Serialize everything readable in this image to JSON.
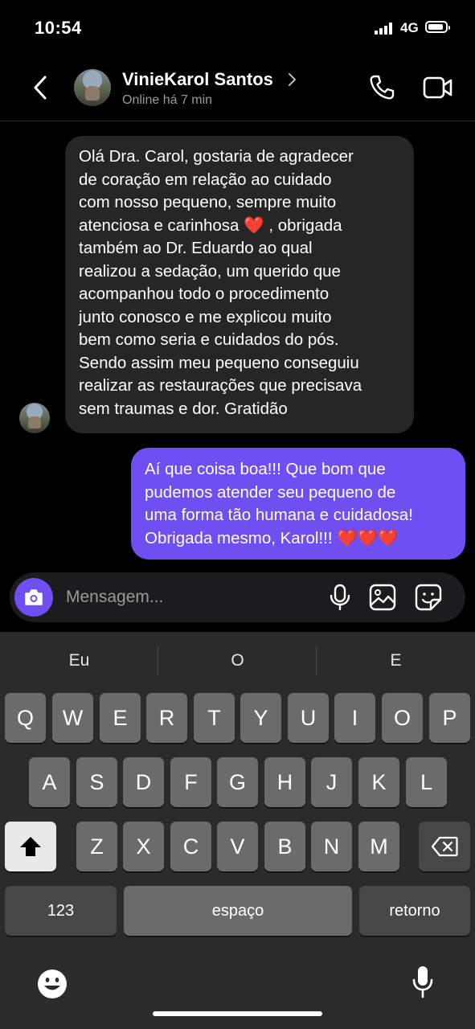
{
  "status_bar": {
    "time": "10:54",
    "network": "4G"
  },
  "header": {
    "contact_name": "VinieKarol Santos",
    "contact_status": "Online há 7 min"
  },
  "messages": [
    {
      "direction": "incoming",
      "text": "Olá Dra. Carol, gostaria de agradecer\nde coração em relação ao cuidado\ncom nosso pequeno, sempre muito\natenciosa e carinhosa ❤️ , obrigada\ntambém ao Dr. Eduardo ao qual\nrealizou a sedação, um querido que\nacompanhou todo o procedimento\njunto conosco e me explicou muito\nbem como seria e cuidados do pós.\nSendo assim meu pequeno conseguiu\nrealizar as restaurações que precisava\nsem traumas e dor. Gratidão"
    },
    {
      "direction": "outgoing",
      "text": "Aí que coisa boa!!! Que bom que\npudemos atender seu pequeno de\numa forma tão humana e cuidadosa!\nObrigada mesmo, Karol!!! ❤️❤️❤️"
    }
  ],
  "composer": {
    "placeholder": "Mensagem...",
    "accent_color": "#6f4ff2"
  },
  "keyboard": {
    "suggestions": [
      "Eu",
      "O",
      "E"
    ],
    "row1": [
      "Q",
      "W",
      "E",
      "R",
      "T",
      "Y",
      "U",
      "I",
      "O",
      "P"
    ],
    "row2": [
      "A",
      "S",
      "D",
      "F",
      "G",
      "H",
      "J",
      "K",
      "L"
    ],
    "row3": [
      "Z",
      "X",
      "C",
      "V",
      "B",
      "N",
      "M"
    ],
    "numbers_label": "123",
    "space_label": "espaço",
    "return_label": "retorno"
  },
  "icons": [
    "back-chevron-icon",
    "phone-icon",
    "video-icon",
    "camera-icon",
    "microphone-icon",
    "gallery-icon",
    "sticker-icon",
    "shift-icon",
    "backspace-icon",
    "emoji-icon",
    "dictation-icon"
  ]
}
